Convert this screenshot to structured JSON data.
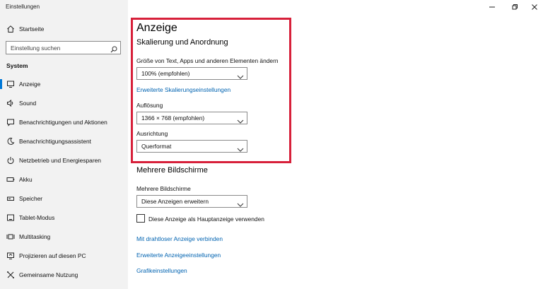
{
  "app": {
    "title": "Einstellungen"
  },
  "window_controls": {
    "minimize_icon": "minimize-icon",
    "restore_icon": "restore-icon",
    "close_icon": "close-icon"
  },
  "sidebar": {
    "home_label": "Startseite",
    "search_placeholder": "Einstellung suchen",
    "section": "System",
    "items": [
      {
        "label": "Anzeige",
        "icon": "monitor-icon",
        "active": true
      },
      {
        "label": "Sound",
        "icon": "speaker-icon"
      },
      {
        "label": "Benachrichtigungen und Aktionen",
        "icon": "notification-icon"
      },
      {
        "label": "Benachrichtigungsassistent",
        "icon": "moon-icon"
      },
      {
        "label": "Netzbetrieb und Energiesparen",
        "icon": "power-icon"
      },
      {
        "label": "Akku",
        "icon": "battery-icon"
      },
      {
        "label": "Speicher",
        "icon": "storage-icon"
      },
      {
        "label": "Tablet-Modus",
        "icon": "tablet-icon"
      },
      {
        "label": "Multitasking",
        "icon": "multitasking-icon"
      },
      {
        "label": "Projizieren auf diesen PC",
        "icon": "project-icon"
      },
      {
        "label": "Gemeinsame Nutzung",
        "icon": "share-icon"
      }
    ]
  },
  "main": {
    "title": "Anzeige",
    "scaling_section": "Skalierung und Anordnung",
    "scale_label": "Größe von Text, Apps und anderen Elementen ändern",
    "scale_value": "100% (empfohlen)",
    "advanced_scaling_link": "Erweiterte Skalierungseinstellungen",
    "resolution_label": "Auflösung",
    "resolution_value": "1366 × 768 (empfohlen)",
    "orientation_label": "Ausrichtung",
    "orientation_value": "Querformat",
    "multi_section": "Mehrere Bildschirme",
    "multi_label": "Mehrere Bildschirme",
    "multi_value": "Diese Anzeigen erweitern",
    "main_display_checkbox": "Diese Anzeige als Hauptanzeige verwenden",
    "links": [
      "Mit drahtloser Anzeige verbinden",
      "Erweiterte Anzeigeeinstellungen",
      "Grafikeinstellungen"
    ]
  },
  "colors": {
    "accent": "#0078d7",
    "link": "#0063b1",
    "highlight_border": "#d7203a",
    "sidebar_bg": "#f2f2f2"
  }
}
